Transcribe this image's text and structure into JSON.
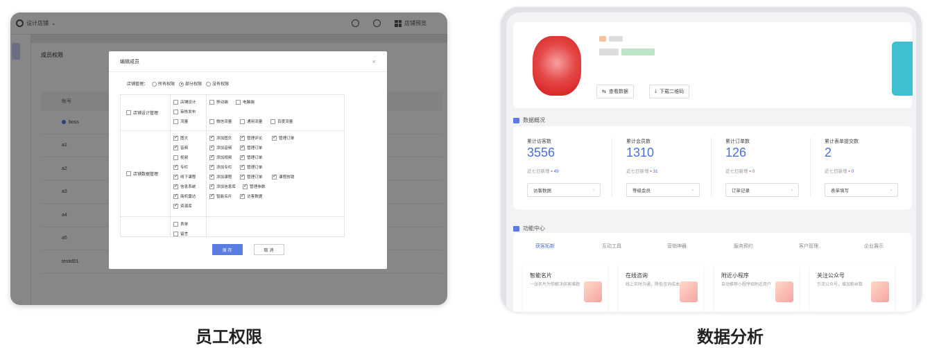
{
  "left": {
    "topbar": {
      "store": "设计店铺",
      "preview": "店铺预览"
    },
    "page_title": "成员权限",
    "table": {
      "header": "帐号",
      "rows": [
        "boss",
        "a1",
        "a2",
        "a3",
        "a4",
        "a5",
        "testid01"
      ]
    },
    "dialog": {
      "title": "编辑成员",
      "close": "×",
      "scope_label": "店铺管理：",
      "scope_options": [
        "所有权限",
        "部分权限",
        "没有权限"
      ],
      "scope_selected": "部分权限",
      "group1": {
        "category": "店铺设计管理",
        "subs": [
          "店铺设计",
          "审核发布",
          "流量"
        ],
        "actions_row1": [
          "移动端",
          "电脑端"
        ],
        "actions_row3": [
          "微信流量",
          "通用流量",
          "百度流量"
        ]
      },
      "group2": {
        "category": "店铺数据管理",
        "subs": [
          "图文",
          "音频",
          "视频",
          "专栏",
          "线下课程",
          "信息系统",
          "商机雷达",
          "资源库"
        ],
        "actions": [
          [
            "添加图文",
            "管理评论",
            "管理订单"
          ],
          [
            "添加音频",
            "管理订单"
          ],
          [
            "添加视频",
            "管理订单"
          ],
          [
            "添加专栏",
            "管理订单"
          ],
          [
            "添加课程",
            "管理订单",
            "课程核销"
          ],
          [
            "添加信息库",
            "管理参数"
          ],
          [
            "智能名片",
            "访客数据"
          ]
        ]
      },
      "group3": {
        "subs": [
          "表单",
          "留言"
        ]
      },
      "save": "保 存",
      "cancel": "取 消"
    }
  },
  "right": {
    "profile": {
      "btn_view": "查看数据",
      "btn_qr": "下载二维码"
    },
    "overview_title": "数据概况",
    "stats": [
      {
        "label": "累计访客数",
        "value": "3556",
        "growth_label": "近七日新增",
        "growth": "49",
        "button": "访客数据"
      },
      {
        "label": "累计会员数",
        "value": "1310",
        "growth_label": "近七日新增",
        "growth": "31",
        "button": "等级会员"
      },
      {
        "label": "累计订单数",
        "value": "126",
        "growth_label": "近七日新增",
        "growth": "0",
        "button": "订单记录"
      },
      {
        "label": "累计表单提交数",
        "value": "2",
        "growth_label": "近七日新增",
        "growth": "0",
        "button": "表单填写"
      }
    ],
    "func_title": "功能中心",
    "tabs": [
      "获客拓新",
      "互动工具",
      "营销神器",
      "服务预约",
      "客户管理",
      "企业展示"
    ],
    "cards": [
      {
        "title": "智能名片",
        "desc": "一张名片为你解决获客难题"
      },
      {
        "title": "在线咨询",
        "desc": "线上实时沟通，降低咨询成本"
      },
      {
        "title": "附近小程序",
        "desc": "自动推荐小程序给附近用户"
      },
      {
        "title": "关注公众号",
        "desc": "引流公众号，增加粉丝数"
      }
    ]
  },
  "captions": {
    "left": "员工权限",
    "right": "数据分析"
  },
  "colors": {
    "accent": "#5b7ce0",
    "stat_number": "#4c6fd6",
    "teal": "#3fbfcf",
    "avatar_red": "#e54848"
  }
}
